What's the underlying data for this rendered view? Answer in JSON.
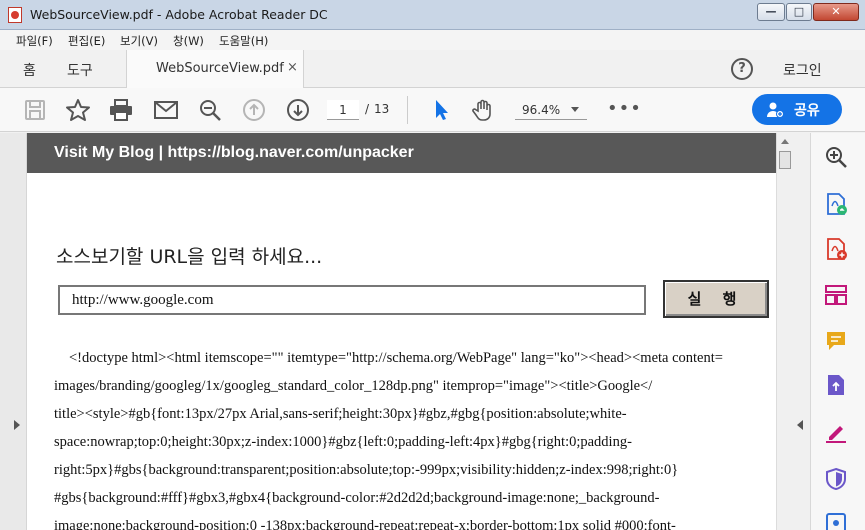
{
  "window": {
    "title": "WebSourceView.pdf - Adobe Acrobat Reader DC",
    "controls": {
      "minimize": "—",
      "maximize": "□",
      "close": "✕"
    }
  },
  "menu": {
    "items": [
      "파일(F)",
      "편집(E)",
      "보기(V)",
      "창(W)",
      "도움말(H)"
    ]
  },
  "tabs": {
    "home": "홈",
    "tools": "도구",
    "document": "WebSourceView.pdf",
    "close_glyph": "×",
    "help_glyph": "?",
    "login": "로그인"
  },
  "toolbar": {
    "current_page": "1",
    "page_separator": "/",
    "total_pages": "13",
    "zoom": "96.4%",
    "more_glyph": "•••",
    "share_label": "공유",
    "accent": "#1473e6",
    "icons": [
      "save-icon",
      "bookmark-star-icon",
      "print-icon",
      "email-icon",
      "zoom-search-icon",
      "page-up-icon",
      "page-down-icon",
      "select-cursor-icon",
      "hand-tool-icon"
    ]
  },
  "document": {
    "banner": "Visit My Blog  |  https://blog.naver.com/unpacker",
    "prompt": "소스보기할 URL을 입력 하세요...",
    "url_value": "http://www.google.com",
    "run_button": "실 행",
    "source_lines": [
      "<!doctype html><html itemscope=\"\" itemtype=\"http://schema.org/WebPage\" lang=\"ko\"><head><meta content=",
      "images/branding/googleg/1x/googleg_standard_color_128dp.png\" itemprop=\"image\"><title>Google</",
      "title><style>#gb{font:13px/27px Arial,sans-serif;height:30px}#gbz,#gbg{position:absolute;white-",
      "space:nowrap;top:0;height:30px;z-index:1000}#gbz{left:0;padding-left:4px}#gbg{right:0;padding-",
      "right:5px}#gbs{background:transparent;position:absolute;top:-999px;visibility:hidden;z-index:998;right:0}",
      "#gbs{background:#fff}#gbx3,#gbx4{background-color:#2d2d2d;background-image:none;_background-",
      "image:none;background-position:0 -138px;background-repeat:repeat-x;border-bottom:1px solid #000;font-"
    ]
  },
  "right_panel": {
    "icons": [
      "zoom-in-panel-icon",
      "export-pdf-icon",
      "create-pdf-icon",
      "organize-pages-icon",
      "comment-icon",
      "send-file-icon",
      "fill-sign-icon",
      "protect-shield-icon",
      "more-tools-icon"
    ],
    "colors": {
      "blue": "#2f6fd6",
      "red": "#d93a2b",
      "magenta": "#c2187a",
      "yellow": "#e8a81a",
      "purple": "#6b57c9"
    }
  }
}
